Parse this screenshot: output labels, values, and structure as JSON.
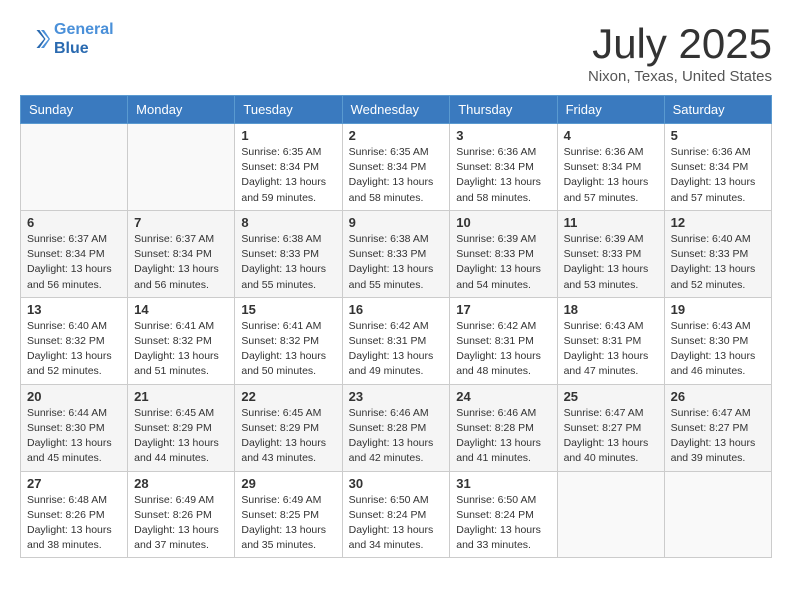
{
  "header": {
    "logo_line1": "General",
    "logo_line2": "Blue",
    "month_year": "July 2025",
    "location": "Nixon, Texas, United States"
  },
  "weekdays": [
    "Sunday",
    "Monday",
    "Tuesday",
    "Wednesday",
    "Thursday",
    "Friday",
    "Saturday"
  ],
  "weeks": [
    [
      {
        "day": "",
        "info": ""
      },
      {
        "day": "",
        "info": ""
      },
      {
        "day": "1",
        "info": "Sunrise: 6:35 AM\nSunset: 8:34 PM\nDaylight: 13 hours\nand 59 minutes."
      },
      {
        "day": "2",
        "info": "Sunrise: 6:35 AM\nSunset: 8:34 PM\nDaylight: 13 hours\nand 58 minutes."
      },
      {
        "day": "3",
        "info": "Sunrise: 6:36 AM\nSunset: 8:34 PM\nDaylight: 13 hours\nand 58 minutes."
      },
      {
        "day": "4",
        "info": "Sunrise: 6:36 AM\nSunset: 8:34 PM\nDaylight: 13 hours\nand 57 minutes."
      },
      {
        "day": "5",
        "info": "Sunrise: 6:36 AM\nSunset: 8:34 PM\nDaylight: 13 hours\nand 57 minutes."
      }
    ],
    [
      {
        "day": "6",
        "info": "Sunrise: 6:37 AM\nSunset: 8:34 PM\nDaylight: 13 hours\nand 56 minutes."
      },
      {
        "day": "7",
        "info": "Sunrise: 6:37 AM\nSunset: 8:34 PM\nDaylight: 13 hours\nand 56 minutes."
      },
      {
        "day": "8",
        "info": "Sunrise: 6:38 AM\nSunset: 8:33 PM\nDaylight: 13 hours\nand 55 minutes."
      },
      {
        "day": "9",
        "info": "Sunrise: 6:38 AM\nSunset: 8:33 PM\nDaylight: 13 hours\nand 55 minutes."
      },
      {
        "day": "10",
        "info": "Sunrise: 6:39 AM\nSunset: 8:33 PM\nDaylight: 13 hours\nand 54 minutes."
      },
      {
        "day": "11",
        "info": "Sunrise: 6:39 AM\nSunset: 8:33 PM\nDaylight: 13 hours\nand 53 minutes."
      },
      {
        "day": "12",
        "info": "Sunrise: 6:40 AM\nSunset: 8:33 PM\nDaylight: 13 hours\nand 52 minutes."
      }
    ],
    [
      {
        "day": "13",
        "info": "Sunrise: 6:40 AM\nSunset: 8:32 PM\nDaylight: 13 hours\nand 52 minutes."
      },
      {
        "day": "14",
        "info": "Sunrise: 6:41 AM\nSunset: 8:32 PM\nDaylight: 13 hours\nand 51 minutes."
      },
      {
        "day": "15",
        "info": "Sunrise: 6:41 AM\nSunset: 8:32 PM\nDaylight: 13 hours\nand 50 minutes."
      },
      {
        "day": "16",
        "info": "Sunrise: 6:42 AM\nSunset: 8:31 PM\nDaylight: 13 hours\nand 49 minutes."
      },
      {
        "day": "17",
        "info": "Sunrise: 6:42 AM\nSunset: 8:31 PM\nDaylight: 13 hours\nand 48 minutes."
      },
      {
        "day": "18",
        "info": "Sunrise: 6:43 AM\nSunset: 8:31 PM\nDaylight: 13 hours\nand 47 minutes."
      },
      {
        "day": "19",
        "info": "Sunrise: 6:43 AM\nSunset: 8:30 PM\nDaylight: 13 hours\nand 46 minutes."
      }
    ],
    [
      {
        "day": "20",
        "info": "Sunrise: 6:44 AM\nSunset: 8:30 PM\nDaylight: 13 hours\nand 45 minutes."
      },
      {
        "day": "21",
        "info": "Sunrise: 6:45 AM\nSunset: 8:29 PM\nDaylight: 13 hours\nand 44 minutes."
      },
      {
        "day": "22",
        "info": "Sunrise: 6:45 AM\nSunset: 8:29 PM\nDaylight: 13 hours\nand 43 minutes."
      },
      {
        "day": "23",
        "info": "Sunrise: 6:46 AM\nSunset: 8:28 PM\nDaylight: 13 hours\nand 42 minutes."
      },
      {
        "day": "24",
        "info": "Sunrise: 6:46 AM\nSunset: 8:28 PM\nDaylight: 13 hours\nand 41 minutes."
      },
      {
        "day": "25",
        "info": "Sunrise: 6:47 AM\nSunset: 8:27 PM\nDaylight: 13 hours\nand 40 minutes."
      },
      {
        "day": "26",
        "info": "Sunrise: 6:47 AM\nSunset: 8:27 PM\nDaylight: 13 hours\nand 39 minutes."
      }
    ],
    [
      {
        "day": "27",
        "info": "Sunrise: 6:48 AM\nSunset: 8:26 PM\nDaylight: 13 hours\nand 38 minutes."
      },
      {
        "day": "28",
        "info": "Sunrise: 6:49 AM\nSunset: 8:26 PM\nDaylight: 13 hours\nand 37 minutes."
      },
      {
        "day": "29",
        "info": "Sunrise: 6:49 AM\nSunset: 8:25 PM\nDaylight: 13 hours\nand 35 minutes."
      },
      {
        "day": "30",
        "info": "Sunrise: 6:50 AM\nSunset: 8:24 PM\nDaylight: 13 hours\nand 34 minutes."
      },
      {
        "day": "31",
        "info": "Sunrise: 6:50 AM\nSunset: 8:24 PM\nDaylight: 13 hours\nand 33 minutes."
      },
      {
        "day": "",
        "info": ""
      },
      {
        "day": "",
        "info": ""
      }
    ]
  ]
}
